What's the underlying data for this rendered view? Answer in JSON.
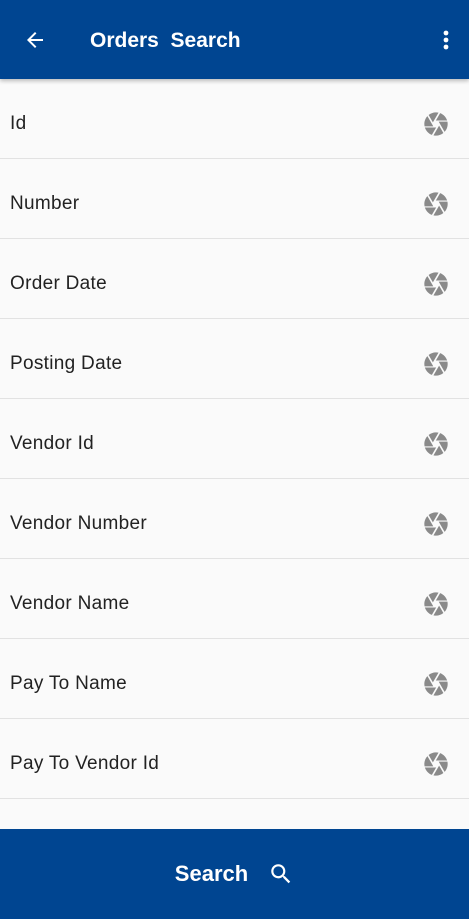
{
  "header": {
    "title": "Orders  Search",
    "back_icon": "arrow-left-icon",
    "more_icon": "more-vertical-icon"
  },
  "fields": [
    {
      "label": "Id"
    },
    {
      "label": "Number"
    },
    {
      "label": "Order Date"
    },
    {
      "label": "Posting Date"
    },
    {
      "label": "Vendor Id"
    },
    {
      "label": "Vendor Number"
    },
    {
      "label": "Vendor Name"
    },
    {
      "label": "Pay To Name"
    },
    {
      "label": "Pay To Vendor Id"
    },
    {
      "label": ""
    }
  ],
  "field_icon": "aperture-icon",
  "footer": {
    "search_label": "Search",
    "search_icon": "search-icon"
  },
  "colors": {
    "primary": "#004591",
    "icon_gray": "#8a8a8a",
    "background": "#fafafa"
  }
}
